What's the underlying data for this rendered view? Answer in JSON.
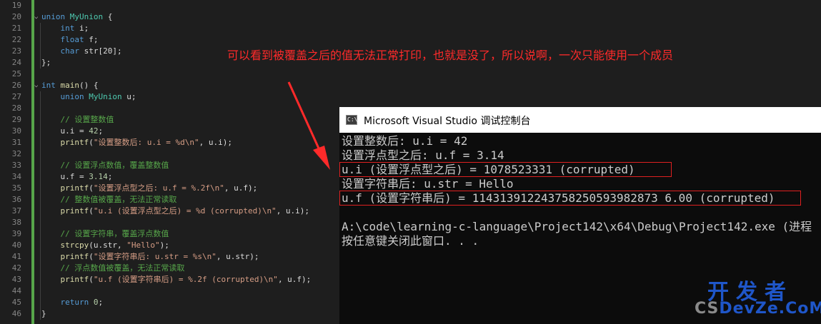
{
  "editor": {
    "line_numbers": [
      "19",
      "20",
      "21",
      "22",
      "23",
      "24",
      "25",
      "26",
      "27",
      "28",
      "29",
      "30",
      "31",
      "32",
      "33",
      "34",
      "35",
      "36",
      "37",
      "38",
      "39",
      "40",
      "41",
      "42",
      "43",
      "44",
      "45",
      "46"
    ],
    "lines": [
      [],
      [
        [
          "kw",
          "union"
        ],
        [
          "",
          "​ "
        ],
        [
          "ty",
          "MyUnion"
        ],
        [
          "",
          " {"
        ]
      ],
      [
        [
          "",
          "    "
        ],
        [
          "kw",
          "int"
        ],
        [
          "",
          " i;"
        ]
      ],
      [
        [
          "",
          "    "
        ],
        [
          "kw",
          "float"
        ],
        [
          "",
          " f;"
        ]
      ],
      [
        [
          "",
          "    "
        ],
        [
          "kw",
          "char"
        ],
        [
          "",
          " str[20];"
        ]
      ],
      [
        [
          "",
          "};"
        ]
      ],
      [],
      [
        [
          "kw",
          "int"
        ],
        [
          "",
          " "
        ],
        [
          "fn",
          "main"
        ],
        [
          "",
          "() {"
        ]
      ],
      [
        [
          "",
          "    "
        ],
        [
          "kw",
          "union"
        ],
        [
          "",
          " "
        ],
        [
          "ty",
          "MyUnion"
        ],
        [
          "",
          " u;"
        ]
      ],
      [],
      [
        [
          "",
          "    "
        ],
        [
          "cm",
          "// 设置整数值"
        ]
      ],
      [
        [
          "",
          "    u.i = "
        ],
        [
          "nu",
          "42"
        ],
        [
          "",
          ";"
        ]
      ],
      [
        [
          "",
          "    "
        ],
        [
          "fn",
          "printf"
        ],
        [
          "",
          "("
        ],
        [
          "st",
          "\"设置整数后: u.i = %d\\n\""
        ],
        [
          "",
          ", u.i);"
        ]
      ],
      [],
      [
        [
          "",
          "    "
        ],
        [
          "cm",
          "// 设置浮点数值，覆盖整数值"
        ]
      ],
      [
        [
          "",
          "    u.f = "
        ],
        [
          "nu",
          "3.14"
        ],
        [
          "",
          ";"
        ]
      ],
      [
        [
          "",
          "    "
        ],
        [
          "fn",
          "printf"
        ],
        [
          "",
          "("
        ],
        [
          "st",
          "\"设置浮点型之后: u.f = %.2f\\n\""
        ],
        [
          "",
          ", u.f);"
        ]
      ],
      [
        [
          "",
          "    "
        ],
        [
          "cm",
          "// 整数值被覆盖，无法正常读取"
        ]
      ],
      [
        [
          "",
          "    "
        ],
        [
          "fn",
          "printf"
        ],
        [
          "",
          "("
        ],
        [
          "st",
          "\"u.i (设置浮点型之后) = %d (corrupted)\\n\""
        ],
        [
          "",
          ", u.i);"
        ]
      ],
      [],
      [
        [
          "",
          "    "
        ],
        [
          "cm",
          "// 设置字符串，覆盖浮点数值"
        ]
      ],
      [
        [
          "",
          "    "
        ],
        [
          "fn",
          "strcpy"
        ],
        [
          "",
          "(u.str, "
        ],
        [
          "st",
          "\"Hello\""
        ],
        [
          "",
          ");"
        ]
      ],
      [
        [
          "",
          "    "
        ],
        [
          "fn",
          "printf"
        ],
        [
          "",
          "("
        ],
        [
          "st",
          "\"设置字符串后: u.str = %s\\n\""
        ],
        [
          "",
          ", u.str);"
        ]
      ],
      [
        [
          "",
          "    "
        ],
        [
          "cm",
          "// 浮点数值被覆盖，无法正常读取"
        ]
      ],
      [
        [
          "",
          "    "
        ],
        [
          "fn",
          "printf"
        ],
        [
          "",
          "("
        ],
        [
          "st",
          "\"u.f (设置字符串后) = %.2f (corrupted)\\n\""
        ],
        [
          "",
          ", u.f);"
        ]
      ],
      [],
      [
        [
          "",
          "    "
        ],
        [
          "kw",
          "return"
        ],
        [
          "",
          " "
        ],
        [
          "nu",
          "0"
        ],
        [
          "",
          ";"
        ]
      ],
      [
        [
          "",
          "}"
        ]
      ]
    ]
  },
  "annotation": {
    "text": "可以看到被覆盖之后的值无法正常打印，也就是没了，所以说啊，一次只能使用一个成员",
    "color": "#ff2a2a"
  },
  "console": {
    "title": "Microsoft Visual Studio 调试控制台",
    "icon": "console-app-icon",
    "icon_glyph": "C:\\",
    "output": [
      "设置整数后: u.i = 42",
      "设置浮点型之后: u.f = 3.14",
      "u.i (设置浮点型之后) = 1078523331 (corrupted)",
      "设置字符串后: u.str = Hello",
      "u.f (设置字符串后) = 114313912243758250593982873 6.00 (corrupted)",
      "",
      "A:\\code\\learning-c-language\\Project142\\x64\\Debug\\Project142.exe (进程",
      "按任意键关闭此窗口. . ."
    ]
  },
  "watermark": {
    "cn": "开发者",
    "en": "DevZe.CoM",
    "prefix": "CS"
  }
}
